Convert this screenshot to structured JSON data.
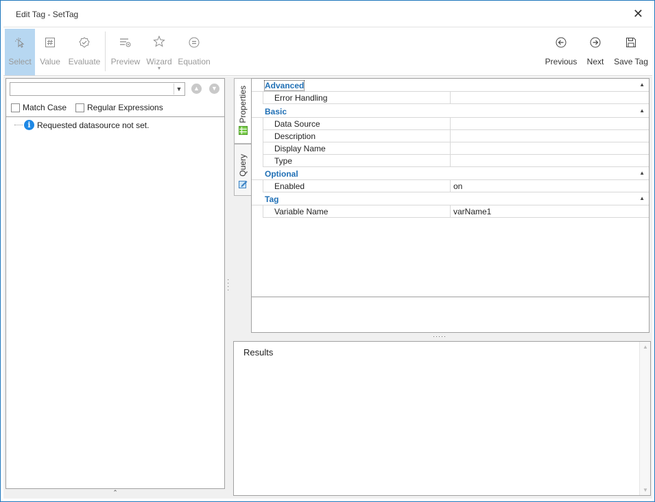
{
  "window": {
    "title": "Edit Tag - SetTag",
    "close_glyph": "✕"
  },
  "ribbon": {
    "select": {
      "label": "Select",
      "icon": "cursor-select-icon"
    },
    "value": {
      "label": "Value",
      "icon": "hash-icon"
    },
    "evaluate": {
      "label": "Evaluate",
      "icon": "check-badge-icon"
    },
    "preview": {
      "label": "Preview",
      "icon": "list-preview-icon"
    },
    "wizard": {
      "label": "Wizard",
      "icon": "wizard-star-icon"
    },
    "equation": {
      "label": "Equation",
      "icon": "equals-circle-icon"
    },
    "previous": {
      "label": "Previous",
      "icon": "arrow-left-circle-icon"
    },
    "next": {
      "label": "Next",
      "icon": "arrow-right-circle-icon"
    },
    "save": {
      "label": "Save Tag",
      "icon": "floppy-disk-icon"
    }
  },
  "left_panel": {
    "search_value": "",
    "match_case_label": "Match Case",
    "regex_label": "Regular Expressions",
    "tree_message": "Requested datasource not set."
  },
  "tabs": [
    {
      "label": "Properties",
      "active": true
    },
    {
      "label": "Query",
      "active": false
    }
  ],
  "properties": {
    "advanced": {
      "title": "Advanced",
      "rows": [
        {
          "name": "Error Handling",
          "value": ""
        }
      ]
    },
    "basic": {
      "title": "Basic",
      "rows": [
        {
          "name": "Data Source",
          "value": ""
        },
        {
          "name": "Description",
          "value": ""
        },
        {
          "name": "Display Name",
          "value": ""
        },
        {
          "name": "Type",
          "value": ""
        }
      ]
    },
    "optional": {
      "title": "Optional",
      "rows": [
        {
          "name": "Enabled",
          "value": "on"
        }
      ]
    },
    "tag": {
      "title": "Tag",
      "rows": [
        {
          "name": "Variable Name",
          "value": "varName1"
        }
      ]
    }
  },
  "results": {
    "title": "Results"
  },
  "colors": {
    "accent": "#1f6fb5",
    "select_highlight": "#b7d7f1",
    "window_border": "#1c75bc"
  }
}
